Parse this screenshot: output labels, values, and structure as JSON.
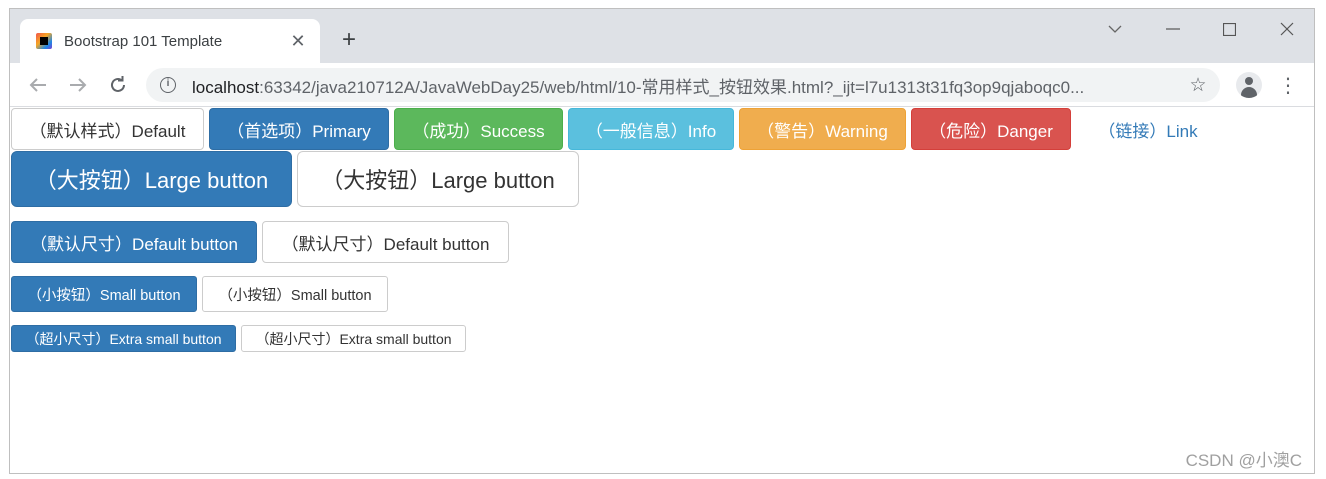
{
  "browser": {
    "tab_title": "Bootstrap 101 Template",
    "tab_close": "✕",
    "new_tab": "+",
    "url_host": "localhost",
    "url_rest": ":63342/java210712A/JavaWebDay25/web/html/10-常用样式_按钮效果.html?_ijt=l7u1313t31fq3op9qjaboqc0...",
    "icons": {
      "back": "back-arrow-icon",
      "forward": "forward-arrow-icon",
      "reload": "reload-icon",
      "info": "info-icon",
      "star": "bookmark-star-icon",
      "avatar": "profile-avatar-icon",
      "menu": "kebab-menu-icon",
      "minimize": "minimize-icon",
      "maximize": "maximize-icon",
      "close": "close-icon",
      "tab_list": "chevron-down-icon"
    }
  },
  "buttons": {
    "row1": [
      {
        "label": "（默认样式）Default",
        "style": "default"
      },
      {
        "label": "（首选项）Primary",
        "style": "primary"
      },
      {
        "label": "（成功）Success",
        "style": "success"
      },
      {
        "label": "（一般信息）Info",
        "style": "info"
      },
      {
        "label": "（警告）Warning",
        "style": "warning"
      },
      {
        "label": "（危险）Danger",
        "style": "danger"
      },
      {
        "label": "（链接）Link",
        "style": "link"
      }
    ],
    "large": [
      {
        "label": "（大按钮）Large button",
        "style": "primary"
      },
      {
        "label": "（大按钮）Large button",
        "style": "default"
      }
    ],
    "default_size": [
      {
        "label": "（默认尺寸）Default button",
        "style": "primary"
      },
      {
        "label": "（默认尺寸）Default button",
        "style": "default"
      }
    ],
    "small": [
      {
        "label": "（小按钮）Small button",
        "style": "primary"
      },
      {
        "label": "（小按钮）Small button",
        "style": "default"
      }
    ],
    "extra_small": [
      {
        "label": "（超小尺寸）Extra small button",
        "style": "primary"
      },
      {
        "label": "（超小尺寸）Extra small button",
        "style": "default"
      }
    ]
  },
  "colors": {
    "primary": "#337ab7",
    "success": "#5cb85c",
    "info": "#5bc0de",
    "warning": "#f0ad4e",
    "danger": "#d9534f",
    "link": "#337ab7"
  },
  "watermark": "CSDN @小澳C"
}
